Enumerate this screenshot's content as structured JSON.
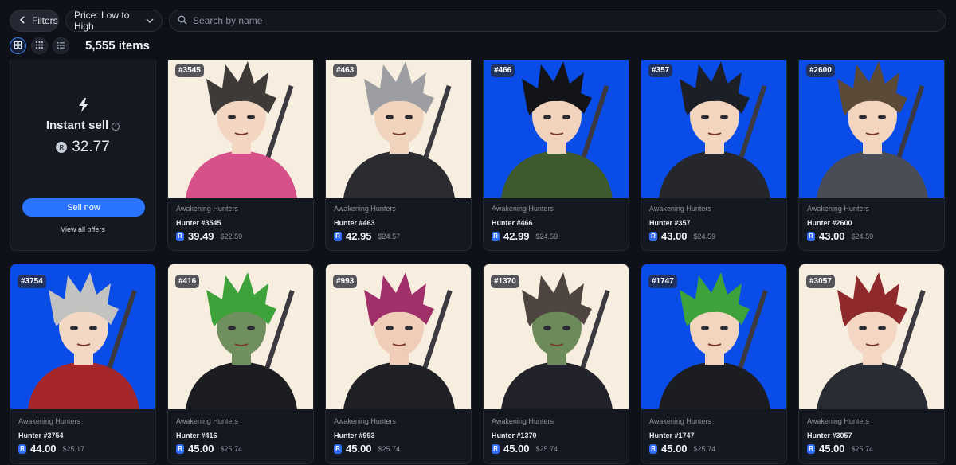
{
  "toolbar": {
    "filters_label": "Filters",
    "sort_label": "Price: Low to High",
    "search_placeholder": "Search by name"
  },
  "view": {
    "item_count": "5,555 items"
  },
  "instant_sell": {
    "title": "Instant sell",
    "price": "32.77",
    "sell_button": "Sell now",
    "offers_link": "View all offers"
  },
  "colors": {
    "accent": "#2a74ff",
    "background": "#0e1117",
    "card": "#141820",
    "art_cream": "#f8eedf",
    "art_blue": "#0a4ce8"
  },
  "items": [
    {
      "tag": "#3545",
      "collection": "Awakening Hunters",
      "name": "Hunter #3545",
      "price": "39.49",
      "usd": "$22.59",
      "bg": "#f8eedf",
      "hair": "#3e3a37",
      "skin": "#f3d6c2",
      "outfit": "#d6508a"
    },
    {
      "tag": "#463",
      "collection": "Awakening Hunters",
      "name": "Hunter #463",
      "price": "42.95",
      "usd": "$24.57",
      "bg": "#f8eedf",
      "hair": "#9c9ea2",
      "skin": "#f1d4be",
      "outfit": "#2a2c30"
    },
    {
      "tag": "#466",
      "collection": "Awakening Hunters",
      "name": "Hunter #466",
      "price": "42.99",
      "usd": "$24.59",
      "bg": "#0a4ce8",
      "hair": "#121418",
      "skin": "#f1d2bc",
      "outfit": "#3f5a2c"
    },
    {
      "tag": "#357",
      "collection": "Awakening Hunters",
      "name": "Hunter #357",
      "price": "43.00",
      "usd": "$24.59",
      "bg": "#0a4ce8",
      "hair": "#1c1f26",
      "skin": "#f2d4bf",
      "outfit": "#25272c"
    },
    {
      "tag": "#2600",
      "collection": "Awakening Hunters",
      "name": "Hunter #2600",
      "price": "43.00",
      "usd": "$24.59",
      "bg": "#0a4ce8",
      "hair": "#5b4a37",
      "skin": "#f2d4bf",
      "outfit": "#4a4d55"
    },
    {
      "tag": "#3754",
      "collection": "Awakening Hunters",
      "name": "Hunter #3754",
      "price": "44.00",
      "usd": "$25.17",
      "bg": "#0a4ce8",
      "hair": "#c2c3c0",
      "skin": "#f3d8c6",
      "outfit": "#a6272a"
    },
    {
      "tag": "#416",
      "collection": "Awakening Hunters",
      "name": "Hunter #416",
      "price": "45.00",
      "usd": "$25.74",
      "bg": "#f8eedf",
      "hair": "#3ea23a",
      "skin": "#6f8f5e",
      "outfit": "#1c1d21"
    },
    {
      "tag": "#993",
      "collection": "Awakening Hunters",
      "name": "Hunter #993",
      "price": "45.00",
      "usd": "$25.74",
      "bg": "#f8eedf",
      "hair": "#a0306a",
      "skin": "#f0cdb8",
      "outfit": "#1f2024"
    },
    {
      "tag": "#1370",
      "collection": "Awakening Hunters",
      "name": "Hunter #1370",
      "price": "45.00",
      "usd": "$25.74",
      "bg": "#f8eedf",
      "hair": "#4f4540",
      "skin": "#6d8a5a",
      "outfit": "#22232a"
    },
    {
      "tag": "#1747",
      "collection": "Awakening Hunters",
      "name": "Hunter #1747",
      "price": "45.00",
      "usd": "$25.74",
      "bg": "#0a4ce8",
      "hair": "#3ea23a",
      "skin": "#f2d4bf",
      "outfit": "#1c1d21"
    },
    {
      "tag": "#3057",
      "collection": "Awakening Hunters",
      "name": "Hunter #3057",
      "price": "45.00",
      "usd": "$25.74",
      "bg": "#f8eedf",
      "hair": "#8e2a2c",
      "skin": "#f3d6c4",
      "outfit": "#2a2c33"
    }
  ]
}
